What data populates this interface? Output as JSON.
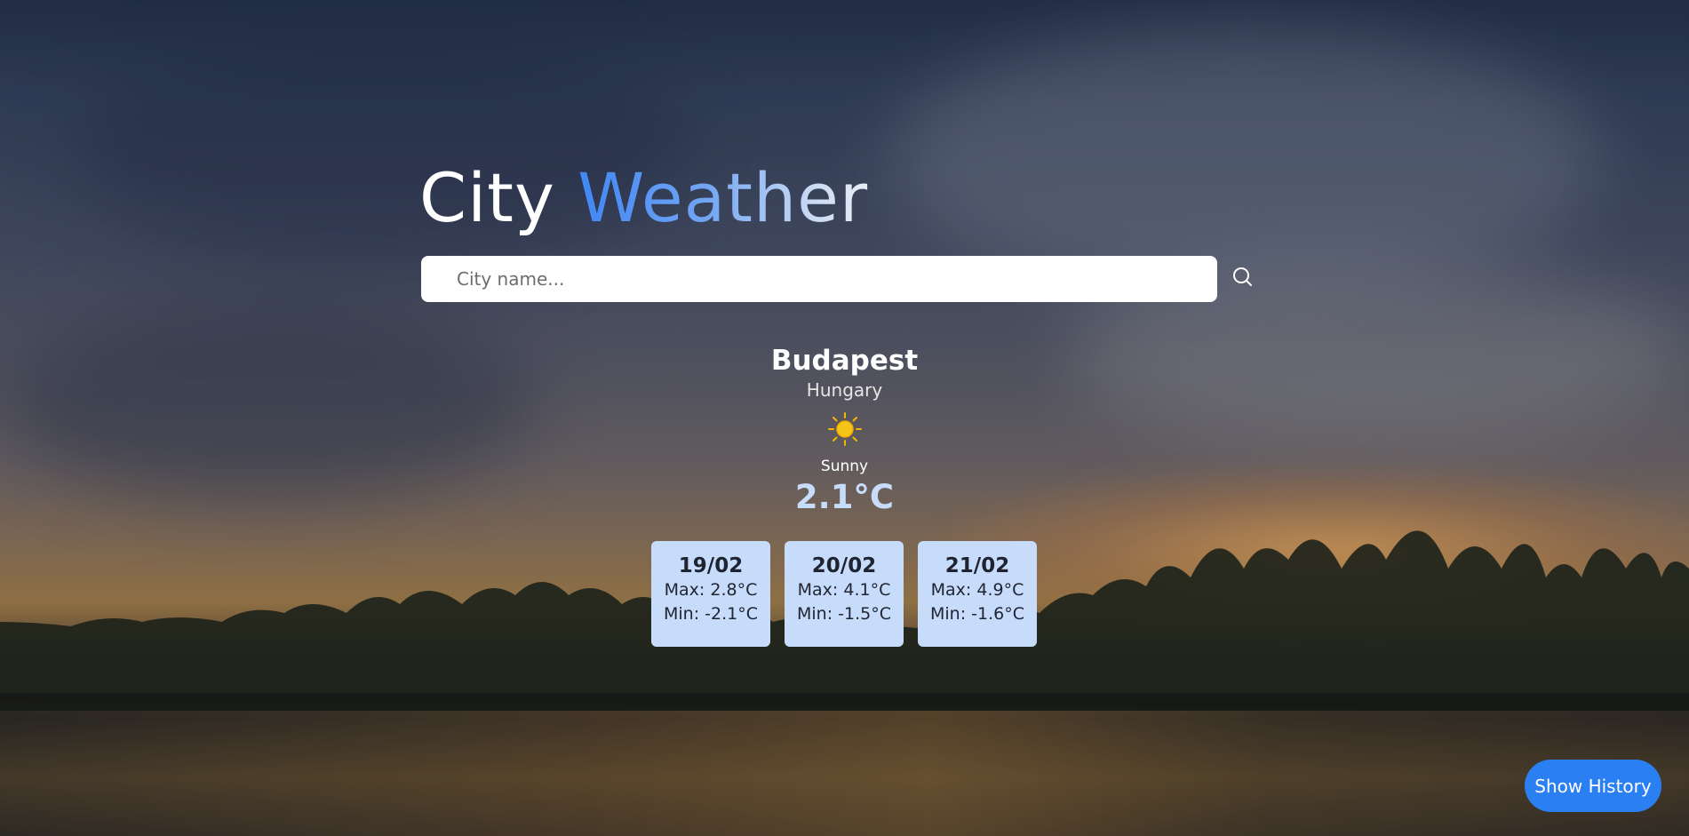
{
  "app": {
    "title_part1": "City ",
    "title_part2": "Weather"
  },
  "search": {
    "placeholder": "City name...",
    "value": "",
    "button_icon": "search-icon"
  },
  "current": {
    "city": "Budapest",
    "country": "Hungary",
    "icon": "sun-icon",
    "condition": "Sunny",
    "temperature": "2.1°C"
  },
  "forecast": [
    {
      "date": "19/02",
      "max": "Max: 2.8°C",
      "min": "Min: -2.1°C"
    },
    {
      "date": "20/02",
      "max": "Max: 4.1°C",
      "min": "Min: -1.5°C"
    },
    {
      "date": "21/02",
      "max": "Max: 4.9°C",
      "min": "Min: -1.6°C"
    }
  ],
  "history": {
    "button_label": "Show History"
  },
  "colors": {
    "accent": "#2a7ff3",
    "card_bg": "#c7dbfb",
    "temperature": "#c7dbfb",
    "sun": "#f5c518"
  }
}
